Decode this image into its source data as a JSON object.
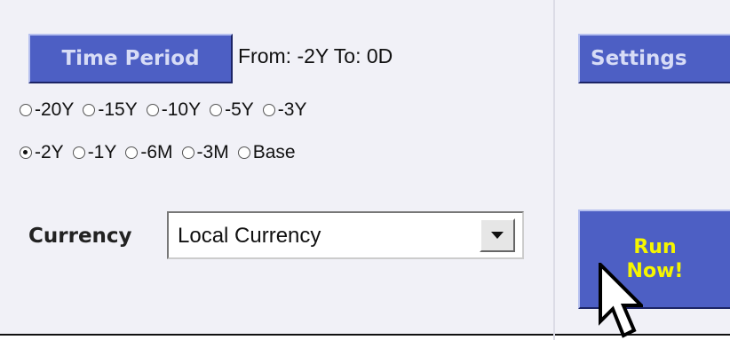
{
  "time_period": {
    "button_label": "Time Period",
    "range_text": "From: -2Y To: 0D"
  },
  "radio_rows": [
    [
      {
        "label": "-20Y",
        "checked": false
      },
      {
        "label": "-15Y",
        "checked": false
      },
      {
        "label": "-10Y",
        "checked": false
      },
      {
        "label": "-5Y",
        "checked": false
      },
      {
        "label": "-3Y",
        "checked": false
      }
    ],
    [
      {
        "label": "-2Y",
        "checked": true
      },
      {
        "label": "-1Y",
        "checked": false
      },
      {
        "label": "-6M",
        "checked": false
      },
      {
        "label": "-3M",
        "checked": false
      },
      {
        "label": "Base",
        "checked": false
      }
    ]
  ],
  "currency": {
    "label": "Currency",
    "value": "Local Currency"
  },
  "settings": {
    "label": "Settings"
  },
  "run_now": {
    "line1": "Run",
    "line2": "Now!"
  },
  "colors": {
    "button_blue": "#4d5fc4",
    "run_text": "#f5f500",
    "panel_bg": "#f1f1f7"
  }
}
